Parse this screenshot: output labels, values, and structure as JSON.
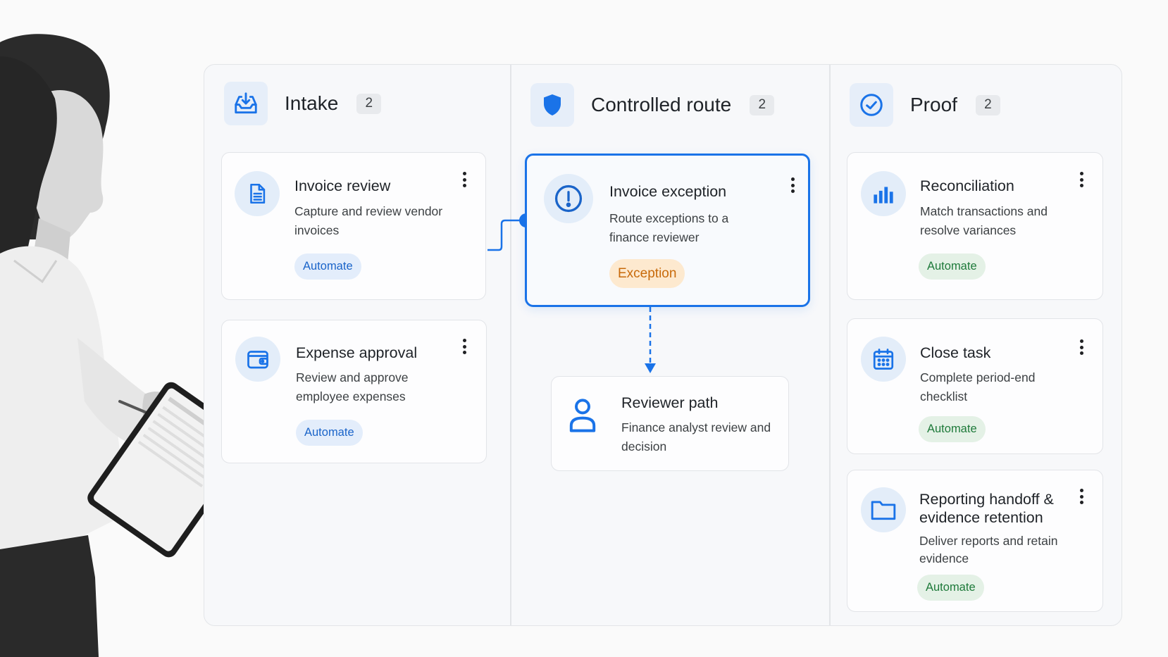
{
  "colors": {
    "accent": "#1a73e8",
    "automate_blue": "#1a64c9",
    "automate_green": "#1e7a3a",
    "exception_orange": "#c86a0b"
  },
  "columns": [
    {
      "title": "Intake",
      "count": "2",
      "icon": "inbox-download-icon",
      "cards": [
        {
          "title": "Invoice review",
          "desc": "Capture and review vendor invoices",
          "badge": "Automate",
          "icon": "document-icon"
        },
        {
          "title": "Expense approval",
          "desc": "Review and approve employee expenses",
          "badge": "Automate",
          "icon": "wallet-icon"
        }
      ]
    },
    {
      "title": "Controlled route",
      "count": "2",
      "icon": "shield-icon",
      "cards": [
        {
          "title": "Invoice exception",
          "desc": "Route exceptions to a finance reviewer",
          "badge": "Exception",
          "icon": "alert-circle-icon"
        },
        {
          "title": "Reviewer path",
          "desc": "Finance analyst review and decision",
          "icon": "person-icon"
        }
      ]
    },
    {
      "title": "Proof",
      "count": "2",
      "icon": "check-circle-icon",
      "cards": [
        {
          "title": "Reconciliation",
          "desc": "Match transactions and resolve variances",
          "badge": "Automate",
          "icon": "bar-chart-icon"
        },
        {
          "title": "Close task",
          "desc": "Complete period-end checklist",
          "badge": "Automate",
          "icon": "calendar-icon"
        },
        {
          "title": "Reporting handoff & evidence retention",
          "desc": "Deliver reports and retain evidence",
          "badge": "Automate",
          "icon": "folder-icon"
        }
      ]
    }
  ]
}
